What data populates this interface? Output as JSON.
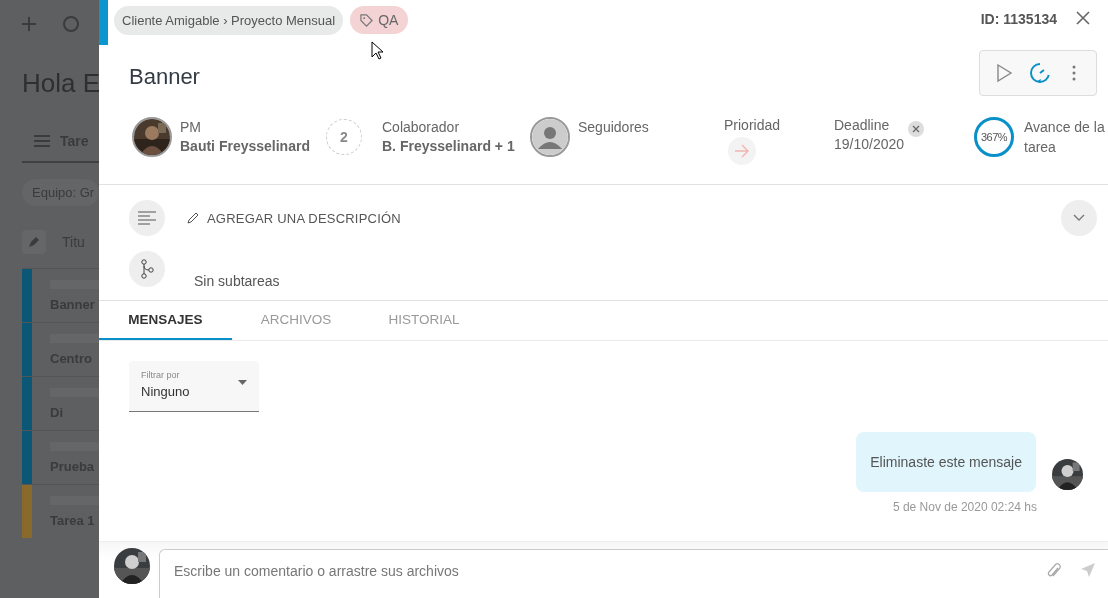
{
  "background": {
    "greeting": "Hola E",
    "tab": "Tare",
    "filter": "Equipo: Gr",
    "column": "Titu",
    "rows": [
      {
        "title": "Banner",
        "color": "#0c5676"
      },
      {
        "title": "Centro",
        "color": "#0c5676"
      },
      {
        "title": "Di",
        "color": "#0c5676"
      },
      {
        "title": "Prueba",
        "color": "#0c5676"
      },
      {
        "title": "Tarea 1",
        "color": "#8a6a2c"
      }
    ]
  },
  "panel": {
    "breadcrumb": "Cliente Amigable › Proyecto Mensual",
    "tag": "QA",
    "id": "ID: 1135134",
    "title": "Banner",
    "people": [
      {
        "label": "PM",
        "name": "Bauti Freysselinard"
      },
      {
        "kind": "count",
        "count": "2",
        "label": "Colaborador",
        "name": "B. Freysselinard + 1"
      },
      {
        "kind": "placeholder",
        "label": "Seguidores"
      }
    ],
    "priority": {
      "label": "Prioridad"
    },
    "deadline": {
      "label": "Deadline",
      "value": "19/10/2020"
    },
    "progress": {
      "reading": "367%",
      "label": "Avance de la tarea"
    },
    "description": "AGREGAR UNA DESCRIPCIÓN",
    "subtasks": "Sin subtareas",
    "tabs": [
      {
        "label": "MENSAJES",
        "selected": true
      },
      {
        "label": "ARCHIVOS",
        "selected": false
      },
      {
        "label": "HISTORIAL",
        "selected": false
      }
    ],
    "filter": {
      "label": "Filtrar por",
      "value": "Ninguno"
    },
    "messages": [
      {
        "text": "Eliminaste este mensaje",
        "time": "5 de Nov de 2020 02:24 hs"
      }
    ],
    "comment": {
      "placeholder": "Escribe un comentario o arrastre sus archivos"
    }
  }
}
